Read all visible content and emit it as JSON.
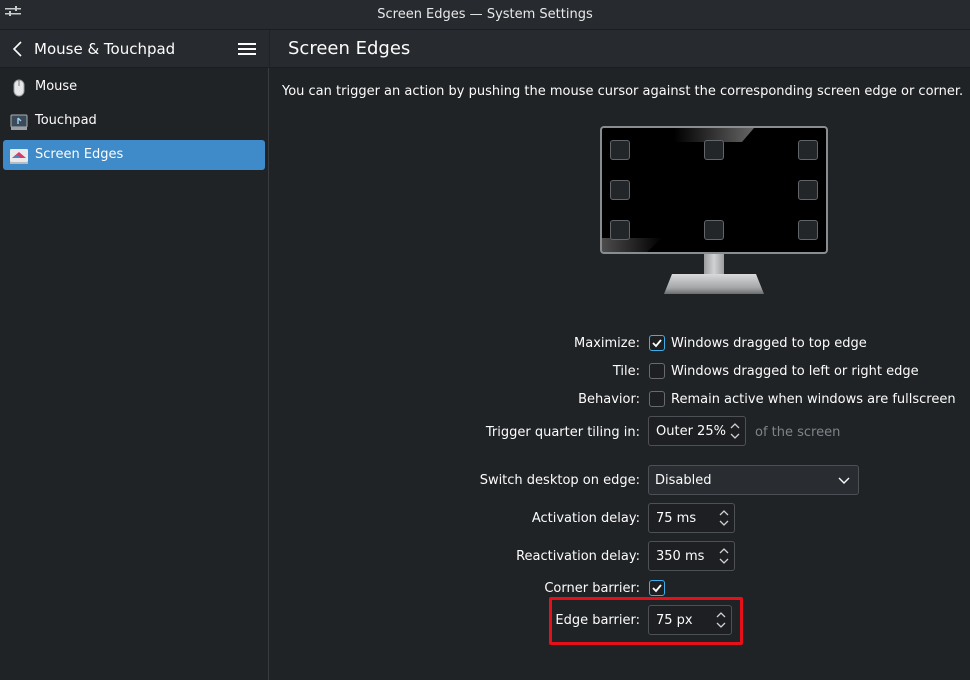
{
  "window": {
    "title": "Screen Edges — System Settings"
  },
  "sidebar": {
    "title": "Mouse & Touchpad",
    "items": [
      {
        "label": "Mouse",
        "icon": "mouse-icon"
      },
      {
        "label": "Touchpad",
        "icon": "touchpad-icon"
      },
      {
        "label": "Screen Edges",
        "icon": "screen-edges-icon",
        "active": true
      }
    ]
  },
  "page": {
    "title": "Screen Edges",
    "description": "You can trigger an action by pushing the mouse cursor against the corresponding screen edge or corner."
  },
  "form": {
    "maximize": {
      "label": "Maximize:",
      "checkbox_label": "Windows dragged to top edge",
      "checked": true
    },
    "tile": {
      "label": "Tile:",
      "checkbox_label": "Windows dragged to left or right edge",
      "checked": false
    },
    "behavior": {
      "label": "Behavior:",
      "checkbox_label": "Remain active when windows are fullscreen",
      "checked": false
    },
    "quarter_tiling": {
      "label": "Trigger quarter tiling in:",
      "value": "Outer 25%",
      "suffix": "of the screen"
    },
    "switch_desktop": {
      "label": "Switch desktop on edge:",
      "value": "Disabled"
    },
    "activation_delay": {
      "label": "Activation delay:",
      "value": "75 ms"
    },
    "reactivation_delay": {
      "label": "Reactivation delay:",
      "value": "350 ms"
    },
    "corner_barrier": {
      "label": "Corner barrier:",
      "checked": true
    },
    "edge_barrier": {
      "label": "Edge barrier:",
      "value": "75 px"
    }
  },
  "colors": {
    "accent": "#3daee9",
    "selection": "#3f8ac8",
    "highlight": "#e5101a"
  }
}
